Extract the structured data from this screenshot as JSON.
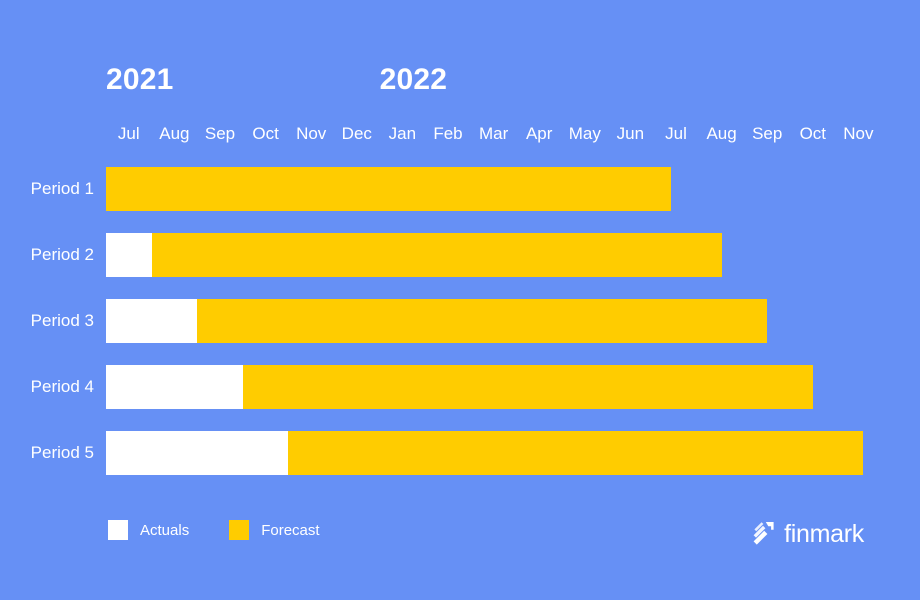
{
  "colors": {
    "background": "#6690F5",
    "actuals": "#FFFFFF",
    "forecast": "#FFCC00",
    "text": "#FFFFFF"
  },
  "axis": {
    "years": [
      {
        "label": "2021",
        "start_month_index": 0
      },
      {
        "label": "2022",
        "start_month_index": 6
      }
    ],
    "months": [
      "Jul",
      "Aug",
      "Sep",
      "Oct",
      "Nov",
      "Dec",
      "Jan",
      "Feb",
      "Mar",
      "Apr",
      "May",
      "Jun",
      "Jul",
      "Aug",
      "Sep",
      "Oct",
      "Nov"
    ]
  },
  "legend": {
    "items": [
      {
        "label": "Actuals",
        "color": "#FFFFFF",
        "swatch": "actuals"
      },
      {
        "label": "Forecast",
        "color": "#FFCC00",
        "swatch": "forecast"
      }
    ]
  },
  "brand": {
    "name": "finmark",
    "mark": "finmark-arrow-logo"
  },
  "chart_data": {
    "type": "bar",
    "subtype": "stacked-horizontal-gantt",
    "title": "",
    "xlabel": "",
    "ylabel": "",
    "categories": [
      "Period 1",
      "Period 2",
      "Period 3",
      "Period 4",
      "Period 5"
    ],
    "x_tick_labels": [
      "Jul",
      "Aug",
      "Sep",
      "Oct",
      "Nov",
      "Dec",
      "Jan",
      "Feb",
      "Mar",
      "Apr",
      "May",
      "Jun",
      "Jul",
      "Aug",
      "Sep",
      "Oct",
      "Nov"
    ],
    "x_group_labels": [
      "2021",
      "2022"
    ],
    "x_unit": "month",
    "xlim": [
      0,
      17
    ],
    "grid": false,
    "legend_position": "bottom-left",
    "series": [
      {
        "name": "Actuals",
        "color": "#FFFFFF",
        "values": [
          0,
          1,
          2,
          3,
          4
        ]
      },
      {
        "name": "Forecast",
        "color": "#FFCC00",
        "values": [
          12.4,
          12.5,
          12.5,
          12.5,
          12.6
        ]
      }
    ],
    "bars": [
      {
        "category": "Period 1",
        "actuals_months": 0,
        "forecast_months": 12.4,
        "total_months": 12.4,
        "start_month": "Jul 2021",
        "end_month": "Jul 2022"
      },
      {
        "category": "Period 2",
        "actuals_months": 1,
        "forecast_months": 12.5,
        "total_months": 13.5,
        "start_month": "Jul 2021",
        "end_month": "Aug 2022"
      },
      {
        "category": "Period 3",
        "actuals_months": 2,
        "forecast_months": 12.5,
        "total_months": 14.5,
        "start_month": "Jul 2021",
        "end_month": "Sep 2022"
      },
      {
        "category": "Period 4",
        "actuals_months": 3,
        "forecast_months": 12.5,
        "total_months": 15.5,
        "start_month": "Jul 2021",
        "end_month": "Oct 2022"
      },
      {
        "category": "Period 5",
        "actuals_months": 4,
        "forecast_months": 12.6,
        "total_months": 16.6,
        "start_month": "Jul 2021",
        "end_month": "Nov 2022"
      }
    ]
  }
}
